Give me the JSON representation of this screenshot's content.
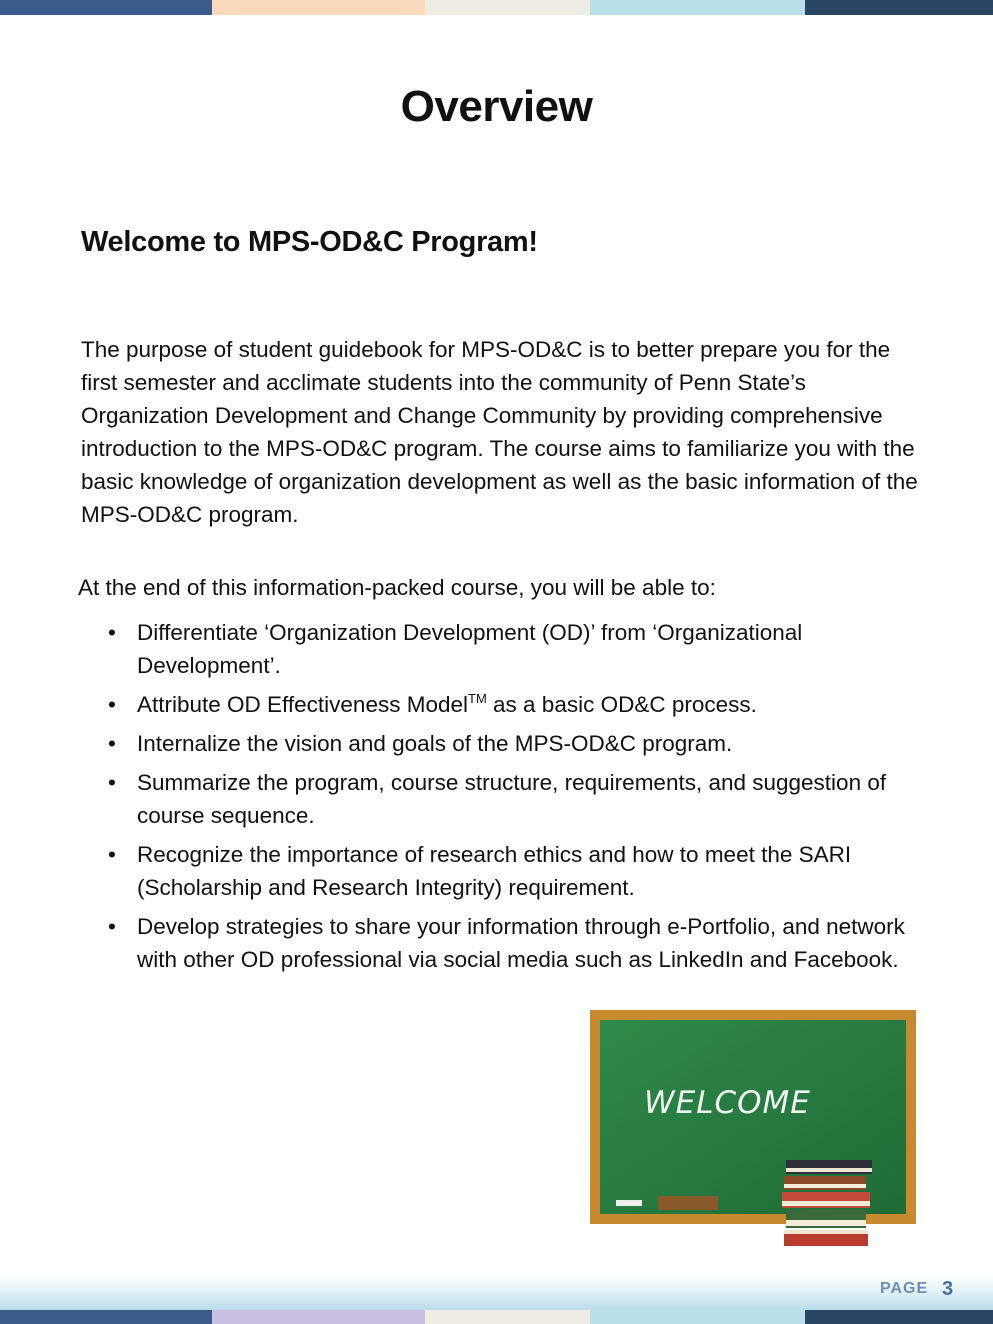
{
  "colors": {
    "top_bar": [
      "#3b5b8c",
      "#fbd9bd",
      "#efece3",
      "#b9e0e9",
      "#2a4563"
    ],
    "bottom_bar": [
      "#3b5b8c",
      "#c9bfe0",
      "#efece3",
      "#b9e0e9",
      "#2a4563"
    ],
    "page_number": "#4a6fa5"
  },
  "page_title": "Overview",
  "subtitle": "Welcome to MPS-OD&C Program!",
  "intro": "The purpose of student guidebook for MPS-OD&C is to better prepare you for the first semester and acclimate students into the community of Penn State’s Organization Development and Change Community by providing comprehensive introduction to the MPS-OD&C program. The course aims to familiarize you with the basic knowledge of organization development as well as the basic information of the MPS-OD&C program.",
  "lead": "At the end of this information-packed course, you will be able to:",
  "objectives": [
    {
      "text": "Differentiate ‘Organization Development (OD)’ from ‘Organizational Development’."
    },
    {
      "text_before": "Attribute OD Effectiveness Model",
      "superscript": "TM",
      "text_after": " as a basic OD&C process."
    },
    {
      "text": "Internalize the vision and goals of the MPS-OD&C program."
    },
    {
      "text": "Summarize the program, course structure, requirements, and suggestion of course sequence."
    },
    {
      "text": "Recognize the importance of research ethics and how to meet the SARI (Scholarship and Research Integrity) requirement."
    },
    {
      "text": "Develop strategies to share your information through e-Portfolio, and network with other OD professional via social media such as LinkedIn and Facebook."
    }
  ],
  "chalkboard": {
    "text": "WELCOME"
  },
  "footer": {
    "page_label": "PAGE",
    "page_number": "3"
  }
}
